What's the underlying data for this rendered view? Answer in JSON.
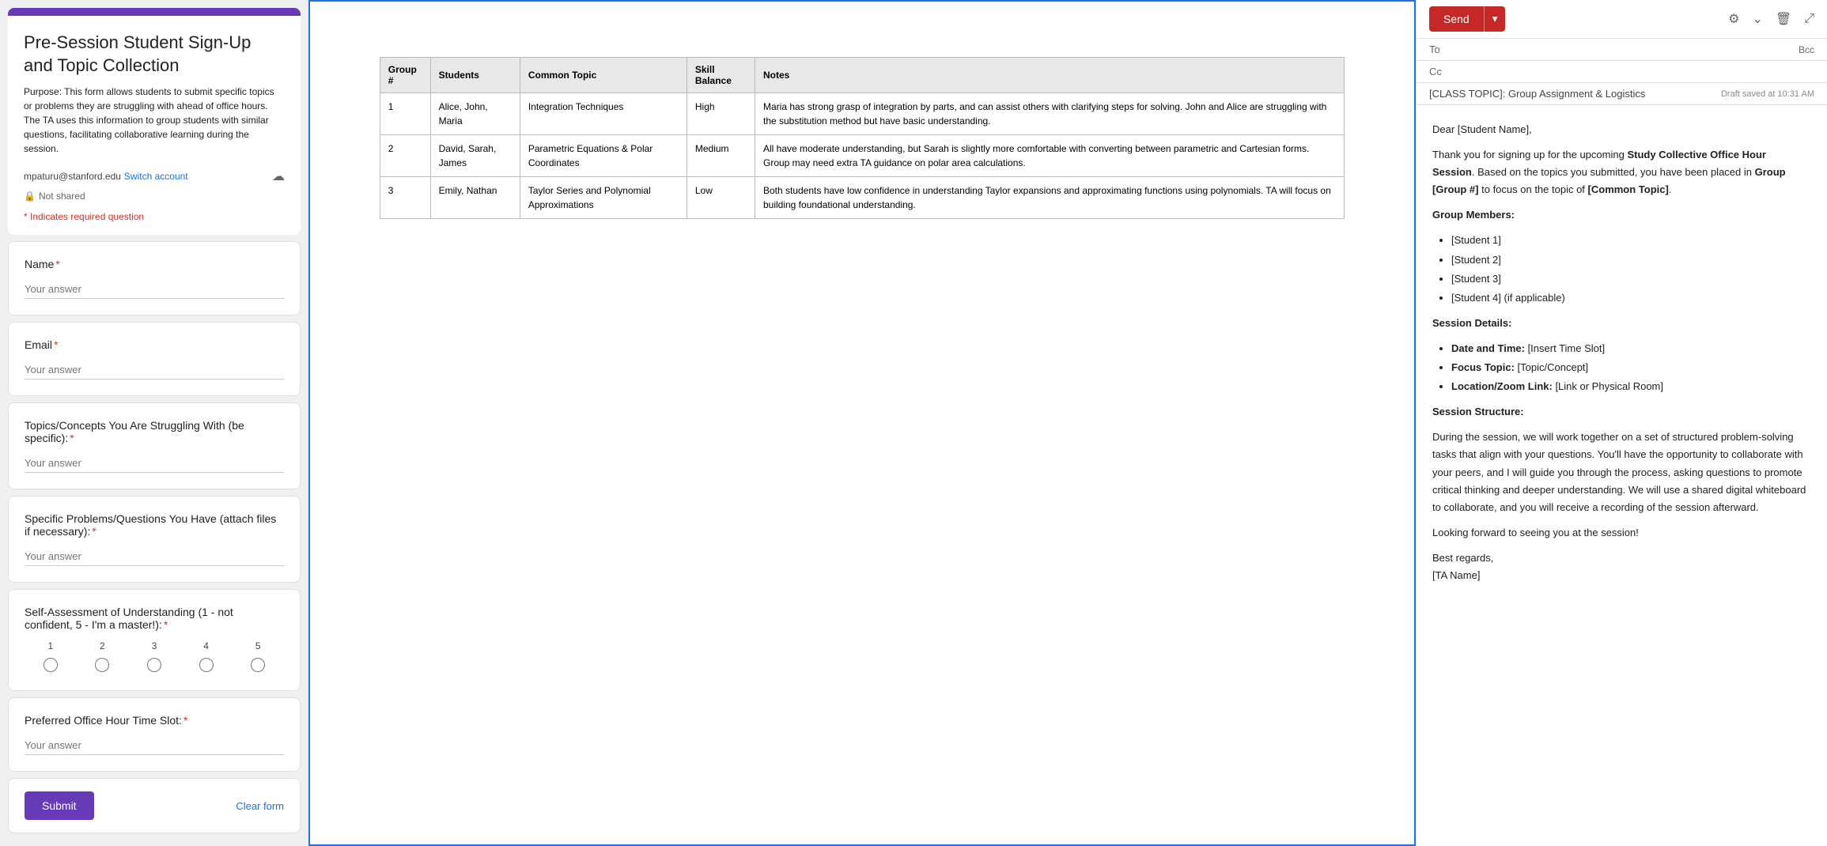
{
  "form": {
    "title": "Pre-Session Student Sign-Up and Topic Collection",
    "description": "Purpose: This form allows students to submit specific topics or problems they are struggling with ahead of office hours. The TA uses this information to group students with similar questions, facilitating collaborative learning during the session.",
    "account_email": "mpaturu@stanford.edu",
    "switch_label": "Switch account",
    "shared_status": "Not shared",
    "required_note": "* Indicates required question",
    "fields": [
      {
        "label": "Name",
        "placeholder": "Your answer",
        "required": true
      },
      {
        "label": "Email",
        "placeholder": "Your answer",
        "required": true
      },
      {
        "label": "Topics/Concepts You Are Struggling With (be specific):",
        "placeholder": "Your answer",
        "required": true
      },
      {
        "label": "Specific Problems/Questions You Have (attach files if necessary):",
        "placeholder": "Your answer",
        "required": true
      },
      {
        "label": "Preferred Office Hour Time Slot:",
        "placeholder": "Your answer",
        "required": true
      }
    ],
    "rating_label": "Self-Assessment of Understanding (1 - not confident, 5 - I'm a master!):",
    "rating_required": true,
    "rating_options": [
      "1",
      "2",
      "3",
      "4",
      "5"
    ],
    "submit_label": "Submit",
    "clear_label": "Clear form"
  },
  "table": {
    "columns": [
      "Group #",
      "Students",
      "Common Topic",
      "Skill Balance",
      "Notes"
    ],
    "rows": [
      {
        "group": "1",
        "students": "Alice, John, Maria",
        "topic": "Integration Techniques",
        "skill": "High",
        "notes": "Maria has strong grasp of integration by parts, and can assist others with clarifying steps for solving. John and Alice are struggling with the substitution method but have basic understanding."
      },
      {
        "group": "2",
        "students": "David, Sarah, James",
        "topic": "Parametric Equations & Polar Coordinates",
        "skill": "Medium",
        "notes": "All have moderate understanding, but Sarah is slightly more comfortable with converting between parametric and Cartesian forms. Group may need extra TA guidance on polar area calculations."
      },
      {
        "group": "3",
        "students": "Emily, Nathan",
        "topic": "Taylor Series and Polynomial Approximations",
        "skill": "Low",
        "notes": "Both students have low confidence in understanding Taylor expansions and approximating functions using polynomials. TA will focus on building foundational understanding."
      }
    ]
  },
  "email": {
    "send_label": "Send",
    "to_label": "To",
    "cc_label": "Cc",
    "bcc_label": "Bcc",
    "subject": "[CLASS TOPIC]: Group Assignment & Logistics",
    "draft_saved": "Draft saved at 10:31 AM",
    "greeting": "Dear [Student Name],",
    "body_intro": "Thank you for signing up for the upcoming",
    "body_bold1": "Study Collective Office Hour Session",
    "body_mid": ". Based on the topics you submitted, you have been placed in",
    "body_bold2": "Group [Group #]",
    "body_mid2": "to focus on the topic of",
    "body_bold3": "[Common Topic]",
    "body_end": ".",
    "group_members_header": "Group Members:",
    "members": [
      "[Student 1]",
      "[Student 2]",
      "[Student 3]",
      "[Student 4] (if applicable)"
    ],
    "session_details_header": "Session Details:",
    "session_details": [
      {
        "label": "Date and Time:",
        "value": "[Insert Time Slot]"
      },
      {
        "label": "Focus Topic:",
        "value": "[Topic/Concept]"
      },
      {
        "label": "Location/Zoom Link:",
        "value": "[Link or Physical Room]"
      }
    ],
    "session_structure_header": "Session Structure:",
    "session_structure_text": "During the session, we will work together on a set of structured problem-solving tasks that align with your questions. You'll have the opportunity to collaborate with your peers, and I will guide you through the process, asking questions to promote critical thinking and deeper understanding. We will use a shared digital whiteboard to collaborate, and you will receive a recording of the session afterward.",
    "closing": "Looking forward to seeing you at the session!",
    "regards": "Best regards,",
    "ta_name": "[TA Name]"
  }
}
